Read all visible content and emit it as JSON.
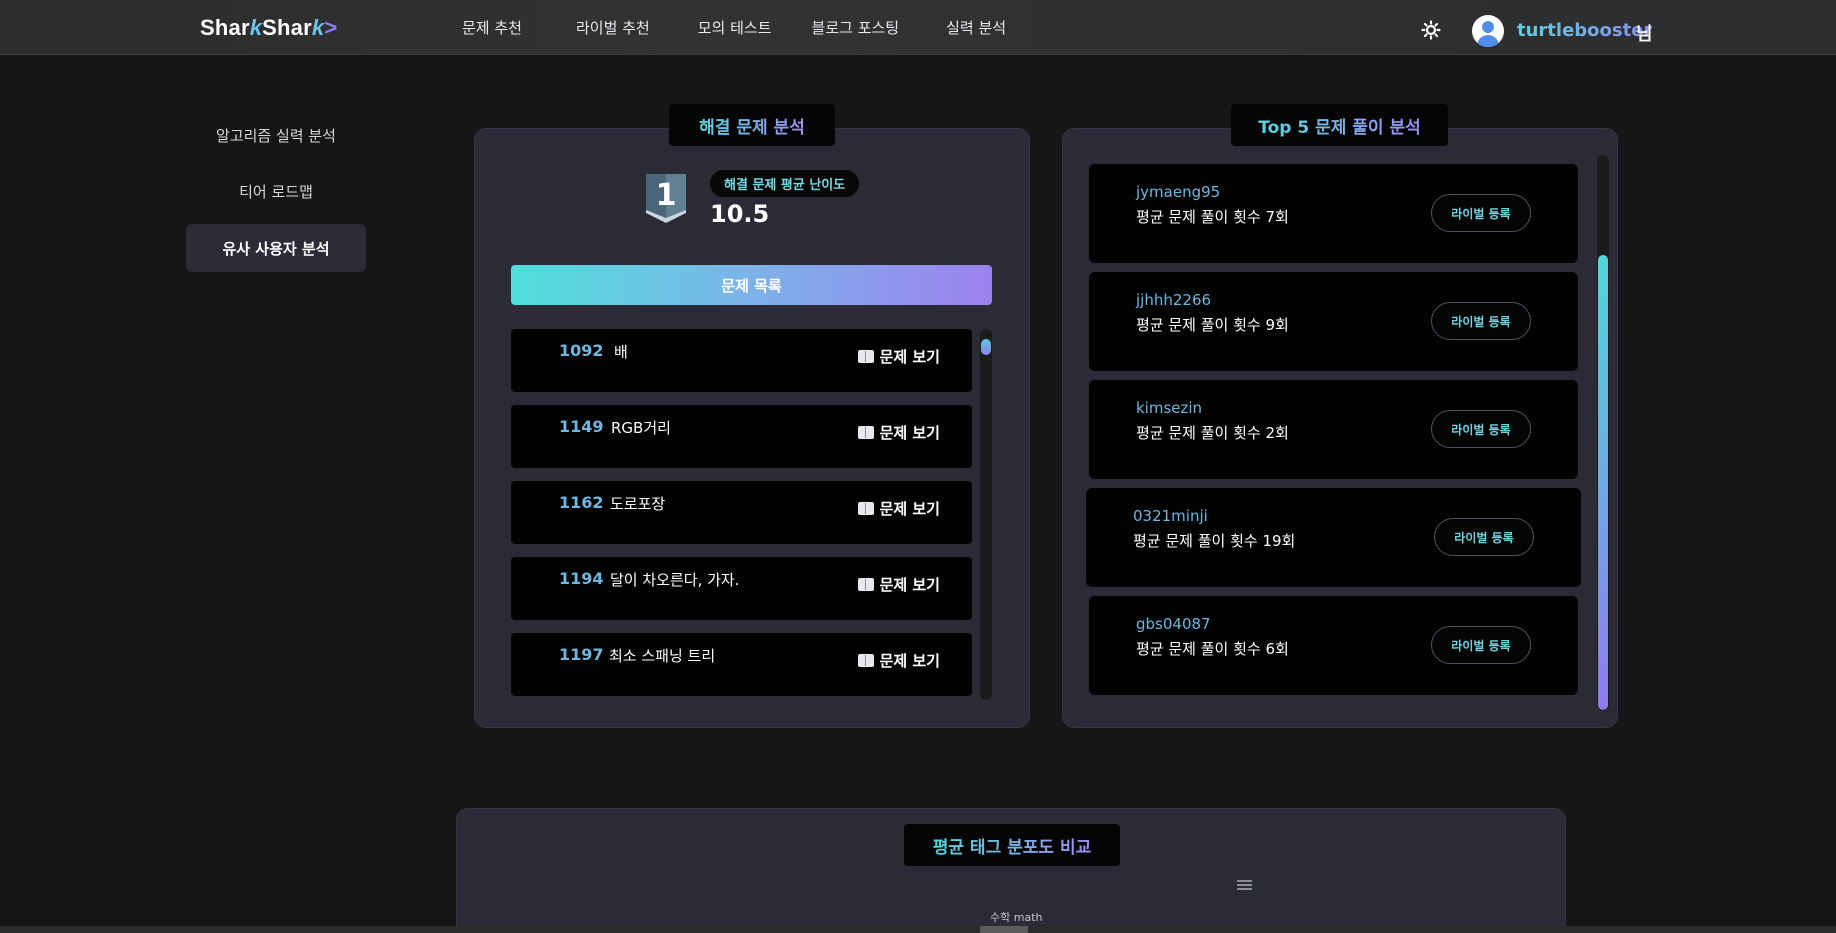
{
  "header": {
    "logo": {
      "part1": "Shar",
      "fin": "k",
      "part2": "Shar",
      "fin2": "k",
      "arrow": ">"
    },
    "nav": [
      "문제 추천",
      "라이벌 추천",
      "모의 테스트",
      "블로그 포스팅",
      "실력 분석"
    ],
    "user": {
      "name": "turtlebooster",
      "suffix": "님"
    },
    "theme_icon": "sun-icon"
  },
  "sidebar": {
    "items": [
      {
        "label": "알고리즘 실력 분석",
        "active": false
      },
      {
        "label": "티어 로드맵",
        "active": false
      },
      {
        "label": "유사 사용자 분석",
        "active": true
      }
    ]
  },
  "solved_panel": {
    "title": "해결 문제 분석",
    "tier_number": "1",
    "avg_label": "해결 문제 평균 난이도",
    "avg_value": "10.5",
    "list_button": "문제 목록",
    "view_label": "문제 보기",
    "problems": [
      {
        "id": "1092",
        "name": "배"
      },
      {
        "id": "1149",
        "name": "RGB거리"
      },
      {
        "id": "1162",
        "name": "도로포장"
      },
      {
        "id": "1194",
        "name": "달이 차오른다, 가자."
      },
      {
        "id": "1197",
        "name": "최소 스패닝 트리"
      }
    ]
  },
  "top5_panel": {
    "title": "Top 5 문제 풀이 분석",
    "register_label": "라이벌 등록",
    "users": [
      {
        "name": "jymaeng95",
        "count": "평균 문제 풀이 횟수 7회"
      },
      {
        "name": "jjhhh2266",
        "count": "평균 문제 풀이 횟수 9회"
      },
      {
        "name": "kimsezin",
        "count": "평균 문제 풀이 횟수 2회"
      },
      {
        "name": "0321minji",
        "count": "평균 문제 풀이 횟수 19회"
      },
      {
        "name": "gbs04087",
        "count": "평균 문제 풀이 횟수 6회"
      }
    ]
  },
  "tag_panel": {
    "title": "평균 태그 분포도 비교",
    "tag_label": "수학 math"
  },
  "colors": {
    "accent_cyan": "#56d6df",
    "accent_purple": "#9f8df2",
    "id_blue": "#6fb6e0",
    "panel_bg": "#2a2b36",
    "page_bg": "#151616"
  }
}
